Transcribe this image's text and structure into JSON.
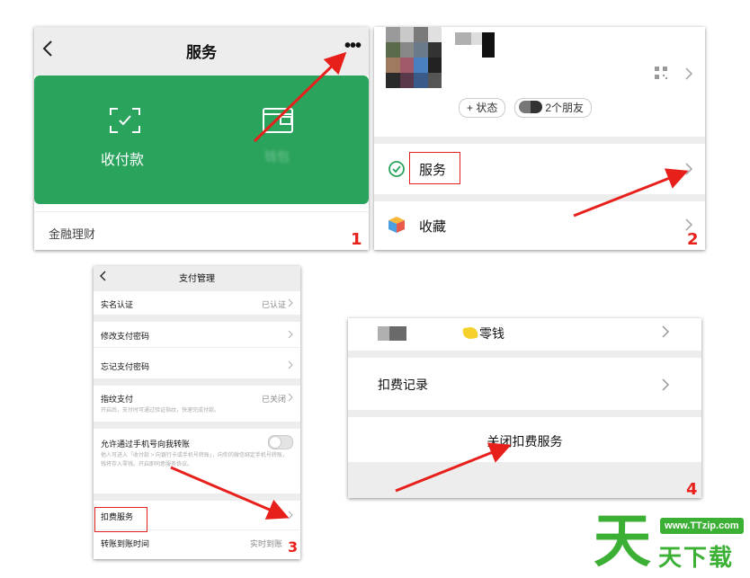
{
  "panel1": {
    "title": "服务",
    "back_icon": "back-arrow-icon",
    "more_icon": "more-dots-icon",
    "green": "#2aa35c",
    "receive_pay_label": "收付款",
    "wallet_label_obscured": "钱包",
    "finance_label": "金融理财",
    "step": "1"
  },
  "panel2": {
    "status_chip": "+ 状态",
    "friends_chip": "2个朋友",
    "services_label": "服务",
    "favorites_label": "收藏",
    "step": "2"
  },
  "panel3": {
    "title": "支付管理",
    "rows": {
      "realname": {
        "label": "实名认证",
        "value": "已认证"
      },
      "change_pwd": {
        "label": "修改支付密码"
      },
      "forgot_pwd": {
        "label": "忘记支付密码"
      },
      "fingerprint": {
        "label": "指纹支付",
        "value": "已关闭",
        "note": "开启后，支付时可通过验证指纹，快速完成付款。"
      },
      "phone_transfer": {
        "label": "允许通过手机号向我转账",
        "note": "他人可进入「收付款 > 向银行卡或手机号转账」，向你的微信绑定手机号转账，钱将存入零钱。开启即同意服务协议。"
      },
      "deduct": {
        "label": "扣费服务"
      },
      "arrival": {
        "label": "转账到账时间",
        "value": "实时到账"
      }
    },
    "step": "3"
  },
  "panel4": {
    "change_label": "零钱",
    "deduct_records": "扣费记录",
    "close_deduct": "关闭扣费服务",
    "step": "4"
  },
  "watermark": {
    "logo_char": "天",
    "site": "www.TTzip.com",
    "brand": "天下载"
  },
  "colors": {
    "accent_red": "#e8201c",
    "wechat_green": "#2aa35c",
    "watermark_green": "#3cb035"
  }
}
